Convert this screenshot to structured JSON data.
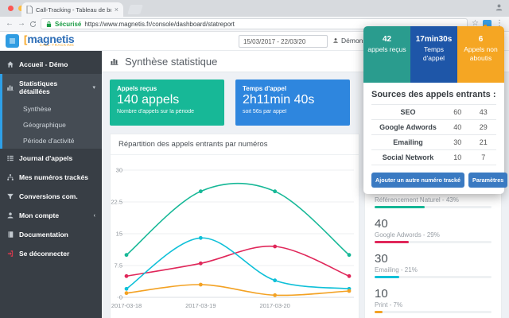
{
  "browser": {
    "tab_title": "Call-Tracking - Tableau de bor",
    "security_label": "Sécurisé",
    "url": "https://www.magnetis.fr/console/dashboard/statreport"
  },
  "navbar": {
    "logo": "magnetis",
    "logo_sub": "CALL-TRACKING",
    "date_range": "15/03/2017 - 22/03/20",
    "user": "Démonstration"
  },
  "sidebar": {
    "home": {
      "label": "Accueil - Démo",
      "icon": "home-icon"
    },
    "stats": {
      "label": "Statistiques détaillées",
      "icon": "bar-chart-icon"
    },
    "sub": [
      "Synthèse",
      "Géographique",
      "Période d'activité"
    ],
    "items": [
      {
        "label": "Journal d'appels",
        "icon": "journal-list-icon"
      },
      {
        "label": "Mes numéros trackés",
        "icon": "tracked-numbers-icon"
      },
      {
        "label": "Conversions com.",
        "icon": "funnel-icon"
      },
      {
        "label": "Mon compte",
        "icon": "user-icon"
      },
      {
        "label": "Documentation",
        "icon": "book-icon"
      },
      {
        "label": "Se déconnecter",
        "icon": "logout-icon"
      }
    ]
  },
  "page": {
    "title": "Synthèse statistique",
    "cards": [
      {
        "label": "Appels reçus",
        "value": "140 appels",
        "sub": "Nombre d'appels sur la période",
        "color": "#17b897"
      },
      {
        "label": "Temps d'appel",
        "value": "2h11min 40s",
        "sub": "soit 56s par appel",
        "color": "#2e86de"
      }
    ],
    "chart_title": "Répartition des appels entrants par numéros"
  },
  "chart_data": {
    "type": "line",
    "x_labels": [
      "2017-03-18",
      "2017-03-19",
      "2017-03-20",
      ""
    ],
    "y_ticks": [
      0,
      7.5,
      15,
      22.5,
      30
    ],
    "ylim": [
      0,
      30
    ],
    "grid": true,
    "legend": "none",
    "series": [
      {
        "name": "SEO",
        "color": "#17b897",
        "values": [
          10,
          25,
          25,
          10
        ]
      },
      {
        "name": "Google Adwords",
        "color": "#e0275a",
        "values": [
          5,
          8,
          12,
          5
        ]
      },
      {
        "name": "Emailing",
        "color": "#0fc0d8",
        "values": [
          2,
          14,
          4,
          2
        ]
      },
      {
        "name": "Print",
        "color": "#f3a224",
        "values": [
          1,
          3,
          0.5,
          1.5
        ]
      }
    ]
  },
  "popup": {
    "blocks": [
      {
        "value": "42",
        "label": "appels reçus",
        "color": "#2a9c8e"
      },
      {
        "value": "17min30s",
        "label": "Temps d'appel",
        "color": "#1e56a8"
      },
      {
        "value": "6",
        "label": "Appels non aboutis",
        "color": "#f5a623"
      }
    ],
    "heading": "Sources des appels entrants :",
    "table": [
      {
        "source": "SEO",
        "calls": "60",
        "pct": "43"
      },
      {
        "source": "Google Adwords",
        "calls": "40",
        "pct": "29"
      },
      {
        "source": "Emailing",
        "calls": "30",
        "pct": "21"
      },
      {
        "source": "Social Network",
        "calls": "10",
        "pct": "7"
      }
    ],
    "add_button": "Ajouter un autre numéro tracké",
    "settings_button": "Paramètres"
  },
  "right_panel": {
    "items": [
      {
        "label": "Référencement Naturel - 43%",
        "pct": 43,
        "color": "#17b897"
      },
      {
        "number": "40",
        "label": "Google Adwords - 29%",
        "pct": 29,
        "color": "#e0275a"
      },
      {
        "number": "30",
        "label": "Emailing - 21%",
        "pct": 21,
        "color": "#0fc0d8"
      },
      {
        "number": "10",
        "label": "Print - 7%",
        "pct": 7,
        "color": "#f3a224"
      }
    ]
  }
}
